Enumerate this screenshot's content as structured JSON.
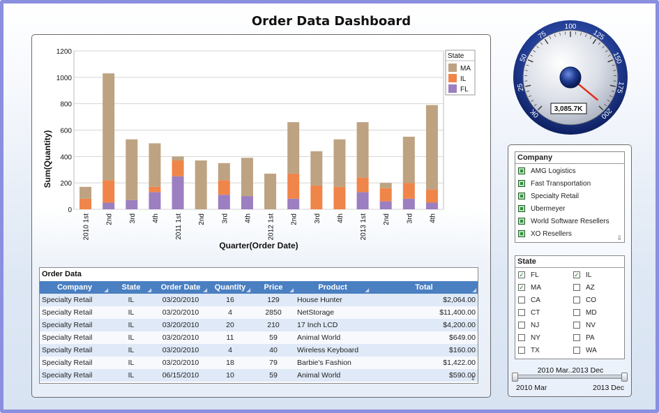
{
  "title": "Order Data Dashboard",
  "chart_data": {
    "type": "bar",
    "stacked": true,
    "xlabel": "Quarter(Order Date)",
    "ylabel": "Sum(Quantity)",
    "ylim": [
      0,
      1200
    ],
    "yticks": [
      0,
      200,
      400,
      600,
      800,
      1000,
      1200
    ],
    "grid": true,
    "legend_title": "State",
    "legend_position": "top-right",
    "categories": [
      "2010 1st",
      "2nd",
      "3rd",
      "4th",
      "2011 1st",
      "2nd",
      "3rd",
      "4th",
      "2012 1st",
      "2nd",
      "3rd",
      "4th",
      "2013 1st",
      "2nd",
      "3rd",
      "4th"
    ],
    "series": [
      {
        "name": "FL",
        "color": "#9b7fc0",
        "values": [
          0,
          50,
          70,
          130,
          250,
          0,
          110,
          100,
          0,
          80,
          0,
          0,
          130,
          60,
          80,
          50
        ]
      },
      {
        "name": "IL",
        "color": "#f0854a",
        "values": [
          80,
          170,
          0,
          40,
          120,
          0,
          110,
          0,
          0,
          190,
          180,
          170,
          110,
          100,
          120,
          100
        ]
      },
      {
        "name": "MA",
        "color": "#bda382",
        "values": [
          90,
          810,
          460,
          330,
          30,
          370,
          130,
          290,
          270,
          390,
          260,
          360,
          420,
          40,
          350,
          640
        ]
      }
    ]
  },
  "gauge": {
    "value_text": "3,085.7K",
    "ticks": [
      "0K",
      "25",
      "50",
      "75",
      "100",
      "125",
      "150",
      "175",
      "200"
    ],
    "value": 196
  },
  "table": {
    "title": "Order Data",
    "columns": [
      "Company",
      "State",
      "Order Date",
      "Quantity",
      "Price",
      "Product",
      "Total"
    ],
    "rows": [
      [
        "Specialty Retail",
        "IL",
        "03/20/2010",
        "16",
        "129",
        "House Hunter",
        "$2,064.00"
      ],
      [
        "Specialty Retail",
        "IL",
        "03/20/2010",
        "4",
        "2850",
        "NetStorage",
        "$11,400.00"
      ],
      [
        "Specialty Retail",
        "IL",
        "03/20/2010",
        "20",
        "210",
        "17 Inch LCD",
        "$4,200.00"
      ],
      [
        "Specialty Retail",
        "IL",
        "03/20/2010",
        "11",
        "59",
        "Animal World",
        "$649.00"
      ],
      [
        "Specialty Retail",
        "IL",
        "03/20/2010",
        "4",
        "40",
        "Wireless Keyboard",
        "$160.00"
      ],
      [
        "Specialty Retail",
        "IL",
        "03/20/2010",
        "18",
        "79",
        "Barbie's Fashion",
        "$1,422.00"
      ],
      [
        "Specialty Retail",
        "IL",
        "06/15/2010",
        "10",
        "59",
        "Animal World",
        "$590.00"
      ]
    ]
  },
  "company_filter": {
    "title": "Company",
    "items": [
      "AMG Logistics",
      "Fast Transportation",
      "Specialty Retail",
      "Ubermeyer",
      "World Software Resellers",
      "XO Resellers"
    ]
  },
  "state_filter": {
    "title": "State",
    "items": [
      {
        "label": "FL",
        "checked": true
      },
      {
        "label": "IL",
        "checked": true
      },
      {
        "label": "MA",
        "checked": true
      },
      {
        "label": "AZ",
        "checked": false
      },
      {
        "label": "CA",
        "checked": false
      },
      {
        "label": "CO",
        "checked": false
      },
      {
        "label": "CT",
        "checked": false
      },
      {
        "label": "MD",
        "checked": false
      },
      {
        "label": "NJ",
        "checked": false
      },
      {
        "label": "NV",
        "checked": false
      },
      {
        "label": "NY",
        "checked": false
      },
      {
        "label": "PA",
        "checked": false
      },
      {
        "label": "TX",
        "checked": false
      },
      {
        "label": "WA",
        "checked": false
      }
    ]
  },
  "date_slider": {
    "range_label": "2010 Mar..2013 Dec",
    "min_label": "2010 Mar",
    "max_label": "2013 Dec"
  }
}
